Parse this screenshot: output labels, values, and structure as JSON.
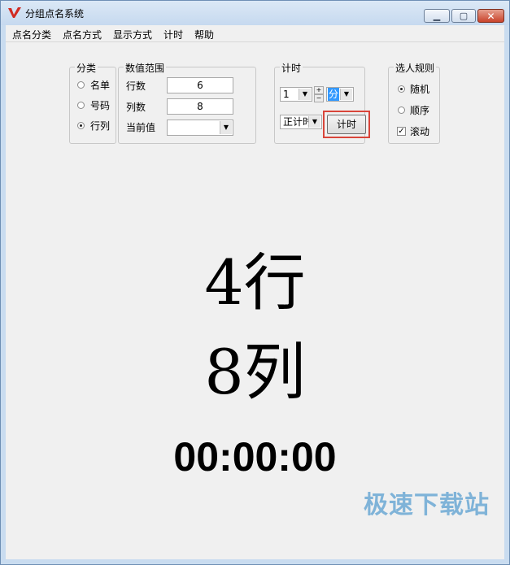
{
  "window": {
    "title": "分组点名系统"
  },
  "menu": [
    "点名分类",
    "点名方式",
    "显示方式",
    "计时",
    "帮助"
  ],
  "classify": {
    "legend": "分类",
    "options": [
      "名单",
      "号码",
      "行列"
    ],
    "selected": 2
  },
  "range": {
    "legend": "数值范围",
    "rows_label": "行数",
    "rows_value": "6",
    "cols_label": "列数",
    "cols_value": "8",
    "current_label": "当前值",
    "current_value": ""
  },
  "timing": {
    "legend": "计时",
    "amount": "1",
    "unit": "分",
    "mode": "正计时",
    "button": "计时"
  },
  "rules": {
    "legend": "选人规则",
    "options": [
      "随机",
      "顺序"
    ],
    "selected": 0,
    "scroll_label": "滚动",
    "scroll_checked": true
  },
  "display": {
    "row": "4行",
    "col": "8列",
    "time": "00:00:00"
  },
  "watermark": "极速下载站",
  "colors": {
    "accent_red": "#d9453a",
    "watermark": "#7fb3d8"
  }
}
